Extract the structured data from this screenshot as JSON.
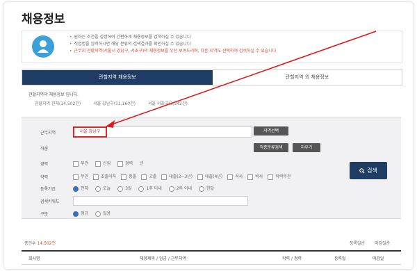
{
  "page_title": "채용정보",
  "info_notes": [
    "원하는 조건을 설정하여 간편하게 채용정보를 검색하실 수 있습니다",
    "직업명을 입력하시면 해당 분류의 검색결과를 확인하실 수 있습니다",
    "근무지 관할지역(서울시 강남구, 서초구)의 채용정보를 우선 보여드리며, 다른 지역도 선택하여 검색하실 수 있습니다"
  ],
  "tabs": [
    "관할지역 채용정보",
    "관할지역 외 채용정보"
  ],
  "region_note": "관할지역의 채용정보 입니다.",
  "region_stats": [
    "관할지역 전체(14,502건)",
    "서울 강남구(11,160건)",
    "서울 서초구(3,342건)"
  ],
  "search": {
    "area_label": "근무지역",
    "area_value": "서울 강남구",
    "area_button": "지역선택",
    "job_label": "직종",
    "job_select_button": "직종분류검색",
    "job_clear_button": "지우기",
    "career_label": "경력",
    "career_options": [
      "무관",
      "신입",
      "경력",
      "년"
    ],
    "edu_label": "학력",
    "edu_options": [
      "무관",
      "초졸이하",
      "중졸",
      "고졸",
      "대졸(2~3년)",
      "대졸(4년)",
      "석사",
      "박사",
      "학력무관"
    ],
    "date_label": "등록기간",
    "date_options": [
      "전체",
      "오늘",
      "3일",
      "1주 이내",
      "2주 이내",
      "한달"
    ],
    "keyword_label": "검색키워드",
    "keyword_value": "",
    "type_label": "구분",
    "type_options": [
      "정규",
      "일용"
    ],
    "search_button": "검색"
  },
  "results": {
    "count_label": "총건수",
    "count_value": "14,502건",
    "sort_options": [
      "등록일순",
      "마감일순"
    ],
    "columns": [
      "회사명",
      "채용제목 / 임금 / 근무지역",
      "학력 / 경력",
      "등록일",
      "마감일"
    ]
  },
  "colors": {
    "primary": "#1e3c64",
    "accent": "#e02424",
    "info_icon": "#3b9fd8"
  }
}
